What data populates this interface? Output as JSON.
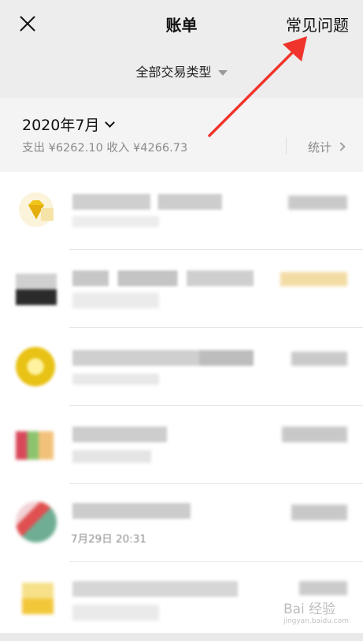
{
  "header": {
    "title": "账单",
    "faq_label": "常见问题",
    "filter_label": "全部交易类型"
  },
  "month_panel": {
    "month": "2020年7月",
    "summary": "支出 ¥6262.10 收入 ¥4266.73",
    "stats_label": "统计"
  },
  "list": {
    "visible_time": "7月29日 20:31"
  },
  "watermark": {
    "main": "Bai 经验",
    "sub": "jingyan.baidu.com"
  },
  "colors": {
    "arrow": "#f0342b",
    "header_bg": "#ededed",
    "panel_bg": "#f4f4f4"
  }
}
